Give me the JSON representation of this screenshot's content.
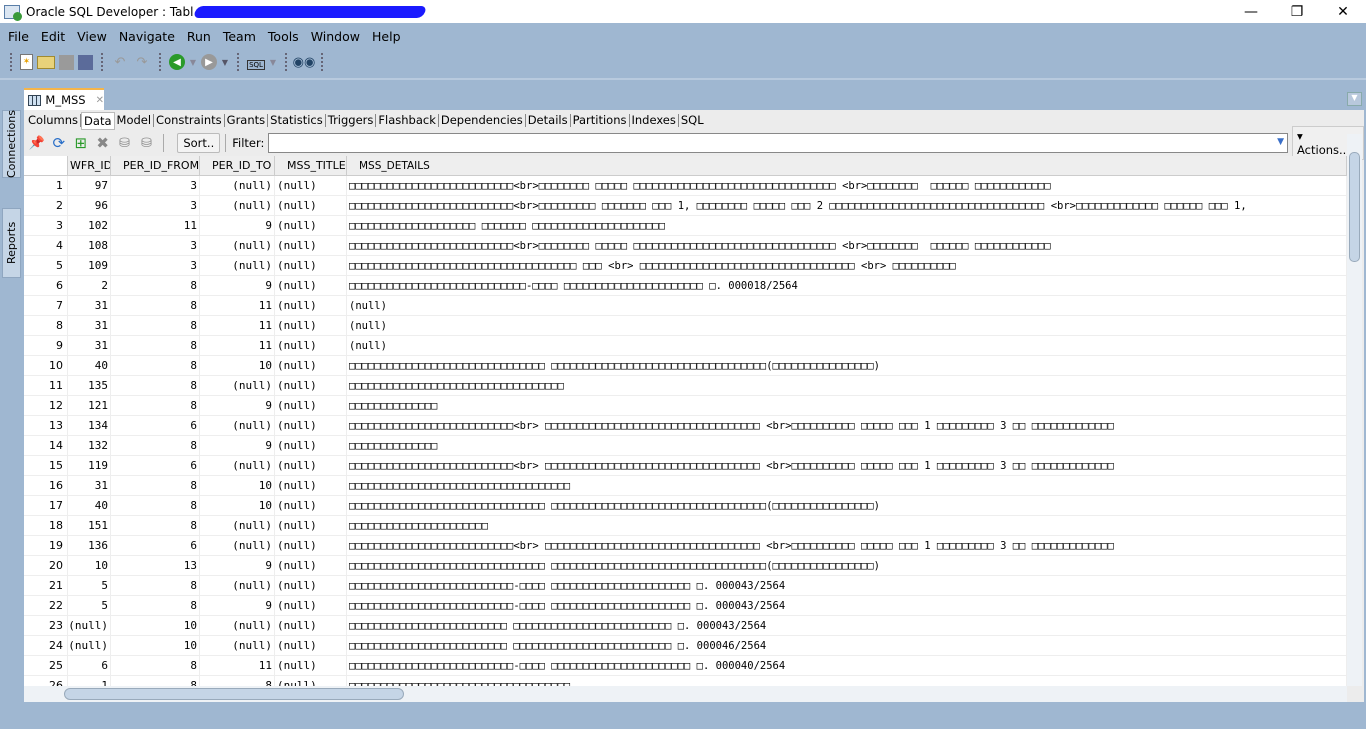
{
  "window": {
    "title": "Oracle SQL Developer : Tabl",
    "minimize": "—",
    "maximize": "❐",
    "close": "✕"
  },
  "menu": [
    "File",
    "Edit",
    "View",
    "Navigate",
    "Run",
    "Team",
    "Tools",
    "Window",
    "Help"
  ],
  "toolbar_icons": [
    "new-file-icon",
    "open-folder-icon",
    "save-icon",
    "save-all-icon",
    "undo-icon",
    "redo-icon",
    "back-icon",
    "forward-icon",
    "sql-worksheet-icon",
    "find-db-object-icon"
  ],
  "side_tabs": {
    "connections": "Connections",
    "reports": "Reports"
  },
  "doc_tab": {
    "label": "M_MSS",
    "close": "✕"
  },
  "sub_tabs": [
    "Columns",
    "Data",
    "Model",
    "Constraints",
    "Grants",
    "Statistics",
    "Triggers",
    "Flashback",
    "Dependencies",
    "Details",
    "Partitions",
    "Indexes",
    "SQL"
  ],
  "active_sub_tab": "Data",
  "grid_toolbar": {
    "sort": "Sort..",
    "filter_label": "Filter:",
    "filter_value": "",
    "actions": "Actions..."
  },
  "columns": [
    "",
    "WFR_ID",
    "PER_ID_FROM",
    "PER_ID_TO",
    "MSS_TITLE",
    "MSS_DETAILS"
  ],
  "rows": [
    [
      "1",
      "97",
      "3",
      "(null)",
      "(null)",
      "□□□□□□□□□□□□□□□□□□□□□□□□□□<br>□□□□□□□□ □□□□□ □□□□□□□□□□□□□□□□□□□□□□□□□□□□□□□□ <br>□□□□□□□□  □□□□□□ □□□□□□□□□□□□"
    ],
    [
      "2",
      "96",
      "3",
      "(null)",
      "(null)",
      "□□□□□□□□□□□□□□□□□□□□□□□□□□<br>□□□□□□□□□ □□□□□□□ □□□ 1, □□□□□□□□ □□□□□ □□□ 2 □□□□□□□□□□□□□□□□□□□□□□□□□□□□□□□□□□ <br>□□□□□□□□□□□□□ □□□□□□ □□□ 1,"
    ],
    [
      "3",
      "102",
      "11",
      "9",
      "(null)",
      "□□□□□□□□□□□□□□□□□□□□ □□□□□□□ □□□□□□□□□□□□□□□□□□□□□"
    ],
    [
      "4",
      "108",
      "3",
      "(null)",
      "(null)",
      "□□□□□□□□□□□□□□□□□□□□□□□□□□<br>□□□□□□□□ □□□□□ □□□□□□□□□□□□□□□□□□□□□□□□□□□□□□□□ <br>□□□□□□□□  □□□□□□ □□□□□□□□□□□□"
    ],
    [
      "5",
      "109",
      "3",
      "(null)",
      "(null)",
      "□□□□□□□□□□□□□□□□□□□□□□□□□□□□□□□□□□□□ □□□ <br> □□□□□□□□□□□□□□□□□□□□□□□□□□□□□□□□□□ <br> □□□□□□□□□□"
    ],
    [
      "6",
      "2",
      "8",
      "9",
      "(null)",
      "□□□□□□□□□□□□□□□□□□□□□□□□□□□□-□□□□ □□□□□□□□□□□□□□□□□□□□□□ □. 000018/2564"
    ],
    [
      "7",
      "31",
      "8",
      "11",
      "(null)",
      "(null)"
    ],
    [
      "8",
      "31",
      "8",
      "11",
      "(null)",
      "(null)"
    ],
    [
      "9",
      "31",
      "8",
      "11",
      "(null)",
      "(null)"
    ],
    [
      "10",
      "40",
      "8",
      "10",
      "(null)",
      "□□□□□□□□□□□□□□□□□□□□□□□□□□□□□□□ □□□□□□□□□□□□□□□□□□□□□□□□□□□□□□□□□□(□□□□□□□□□□□□□□□□)"
    ],
    [
      "11",
      "135",
      "8",
      "(null)",
      "(null)",
      "□□□□□□□□□□□□□□□□□□□□□□□□□□□□□□□□□□"
    ],
    [
      "12",
      "121",
      "8",
      "9",
      "(null)",
      "□□□□□□□□□□□□□□"
    ],
    [
      "13",
      "134",
      "6",
      "(null)",
      "(null)",
      "□□□□□□□□□□□□□□□□□□□□□□□□□□<br> □□□□□□□□□□□□□□□□□□□□□□□□□□□□□□□□□□ <br>□□□□□□□□□□ □□□□□ □□□ 1 □□□□□□□□□ 3 □□ □□□□□□□□□□□□□"
    ],
    [
      "14",
      "132",
      "8",
      "9",
      "(null)",
      "□□□□□□□□□□□□□□"
    ],
    [
      "15",
      "119",
      "6",
      "(null)",
      "(null)",
      "□□□□□□□□□□□□□□□□□□□□□□□□□□<br> □□□□□□□□□□□□□□□□□□□□□□□□□□□□□□□□□□ <br>□□□□□□□□□□ □□□□□ □□□ 1 □□□□□□□□□ 3 □□ □□□□□□□□□□□□□"
    ],
    [
      "16",
      "31",
      "8",
      "10",
      "(null)",
      "□□□□□□□□□□□□□□□□□□□□□□□□□□□□□□□□□□□"
    ],
    [
      "17",
      "40",
      "8",
      "10",
      "(null)",
      "□□□□□□□□□□□□□□□□□□□□□□□□□□□□□□□ □□□□□□□□□□□□□□□□□□□□□□□□□□□□□□□□□□(□□□□□□□□□□□□□□□□)"
    ],
    [
      "18",
      "151",
      "8",
      "(null)",
      "(null)",
      "□□□□□□□□□□□□□□□□□□□□□□"
    ],
    [
      "19",
      "136",
      "6",
      "(null)",
      "(null)",
      "□□□□□□□□□□□□□□□□□□□□□□□□□□<br> □□□□□□□□□□□□□□□□□□□□□□□□□□□□□□□□□□ <br>□□□□□□□□□□ □□□□□ □□□ 1 □□□□□□□□□ 3 □□ □□□□□□□□□□□□□"
    ],
    [
      "20",
      "10",
      "13",
      "9",
      "(null)",
      "□□□□□□□□□□□□□□□□□□□□□□□□□□□□□□□ □□□□□□□□□□□□□□□□□□□□□□□□□□□□□□□□□□(□□□□□□□□□□□□□□□□)"
    ],
    [
      "21",
      "5",
      "8",
      "(null)",
      "(null)",
      "□□□□□□□□□□□□□□□□□□□□□□□□□□-□□□□ □□□□□□□□□□□□□□□□□□□□□□ □. 000043/2564"
    ],
    [
      "22",
      "5",
      "8",
      "9",
      "(null)",
      "□□□□□□□□□□□□□□□□□□□□□□□□□□-□□□□ □□□□□□□□□□□□□□□□□□□□□□ □. 000043/2564"
    ],
    [
      "23",
      "(null)",
      "10",
      "(null)",
      "(null)",
      "□□□□□□□□□□□□□□□□□□□□□□□□□ □□□□□□□□□□□□□□□□□□□□□□□□□ □. 000043/2564"
    ],
    [
      "24",
      "(null)",
      "10",
      "(null)",
      "(null)",
      "□□□□□□□□□□□□□□□□□□□□□□□□□ □□□□□□□□□□□□□□□□□□□□□□□□□ □. 000046/2564"
    ],
    [
      "25",
      "6",
      "8",
      "11",
      "(null)",
      "□□□□□□□□□□□□□□□□□□□□□□□□□□-□□□□ □□□□□□□□□□□□□□□□□□□□□□ □. 000040/2564"
    ],
    [
      "26",
      "1",
      "8",
      "8",
      "(null)",
      "□□□□□□□□□□□□□□□□□□□□□□□□□□□□□□□□□□□"
    ]
  ]
}
